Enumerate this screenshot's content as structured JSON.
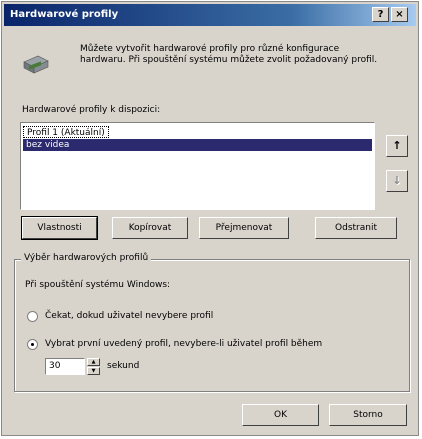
{
  "window": {
    "title": "Hardwarové profily",
    "help_btn": "?",
    "close_btn": "×"
  },
  "intro": {
    "icon": "computer-icon",
    "text": "Můžete vytvořit hardwarové profily pro různé konfigurace hardwaru. Při spouštění systému můžete zvolit požadovaný profil."
  },
  "profiles": {
    "label": "Hardwarové profily k dispozici:",
    "items": [
      "Profil 1 (Aktuální)",
      "bez videa"
    ],
    "selected_index": 1,
    "up_btn": "↑",
    "down_btn": "↓"
  },
  "buttons": {
    "properties": "Vlastnosti",
    "copy": "Kopírovat",
    "rename": "Přejmenovat",
    "delete": "Odstranit"
  },
  "selection": {
    "title": "Výběr hardwarových profilů",
    "startup_label": "Při spouštění systému Windows:",
    "option_wait": "Čekat, dokud uživatel nevybere profil",
    "option_auto": "Vybrat první uvedený profil, nevybere-li uživatel profil během",
    "selected_option": "auto",
    "timeout_value": "30",
    "timeout_unit": "sekund"
  },
  "footer": {
    "ok": "OK",
    "cancel": "Storno"
  },
  "colors": {
    "title_start": "#0a246a",
    "title_end": "#a6caf0",
    "selection": "#2b2a6e",
    "face": "#d8d4cc"
  }
}
